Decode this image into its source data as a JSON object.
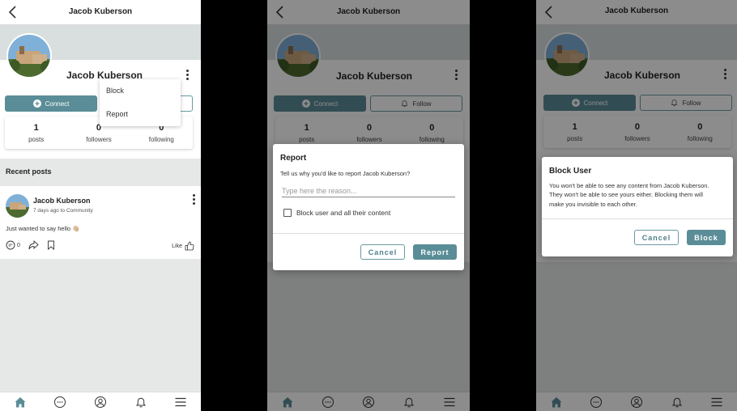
{
  "profile": {
    "name": "Jacob Kuberson",
    "stats": [
      {
        "value": "1",
        "label": "posts"
      },
      {
        "value": "0",
        "label": "followers"
      },
      {
        "value": "0",
        "label": "following"
      }
    ],
    "connect_label": "Connect",
    "follow_label": "Follow"
  },
  "menu": {
    "items": [
      "Block",
      "Report"
    ]
  },
  "feed": {
    "section_title": "Recent posts",
    "post": {
      "author": "Jacob Kuberson",
      "meta": "7 days ago to Community",
      "text": "Just wanted to say hello 👋🏼",
      "comments": "0",
      "like_label": "Like"
    }
  },
  "report_dialog": {
    "title": "Report",
    "subtitle": "Tell us why you'd like to report Jacob Kuberson?",
    "placeholder": "Type here the reason...",
    "checkbox_label": "Block user and all their content",
    "cancel_label": "Cancel",
    "confirm_label": "Report"
  },
  "block_dialog": {
    "title": "Block User",
    "body": "You won't be able to see any content from Jacob Kuberson. They won't be able to see yours either. Blocking them will make you invisible to each other.",
    "cancel_label": "Cancel",
    "confirm_label": "Block"
  },
  "nav": {
    "icons": [
      "home-icon",
      "chat-icon",
      "profile-icon",
      "bell-icon",
      "menu-icon"
    ]
  },
  "colors": {
    "accent": "#5a8d97",
    "background": "#e6e8e8"
  }
}
